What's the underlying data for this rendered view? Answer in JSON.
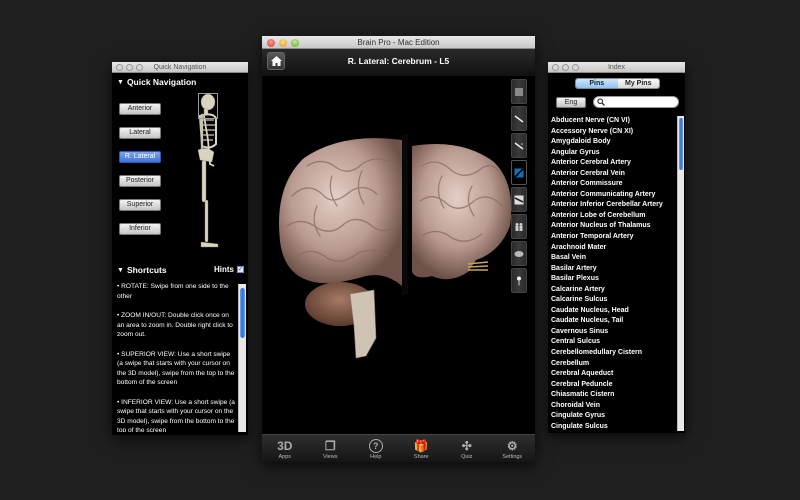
{
  "quick_nav": {
    "window_title": "Quick Navigation",
    "section_title": "Quick Navigation",
    "view_buttons": [
      {
        "label": "Anterior",
        "active": false
      },
      {
        "label": "Lateral",
        "active": false
      },
      {
        "label": "R. Lateral",
        "active": true
      },
      {
        "label": "Posterior",
        "active": false
      },
      {
        "label": "Superior",
        "active": false
      },
      {
        "label": "Inferior",
        "active": false
      }
    ],
    "shortcuts_title": "Shortcuts",
    "hints_label": "Hints",
    "hints_checked": true,
    "shortcuts": [
      "• ROTATE: Swipe from one side to the other",
      "• ZOOM IN/OUT: Double click once on an area to zoom in. Double right click to zoom out.",
      "• SUPERIOR VIEW: Use a short swipe (a swipe that starts with your cursor on the 3D model), swipe from the top to the bottom of the screen",
      "• INFERIOR VIEW: Use a short swipe (a swipe that starts with your cursor on the 3D model), swipe from the bottom to the top of the screen"
    ]
  },
  "main": {
    "window_title": "Brain Pro - Mac Edition",
    "view_title": "R. Lateral: Cerebrum - L5",
    "tools": [
      {
        "icon": "square-icon",
        "active": false
      },
      {
        "icon": "scalpel-icon",
        "active": false
      },
      {
        "icon": "scalpel-alt-icon",
        "active": false
      },
      {
        "icon": "slice-active-icon",
        "active": true
      },
      {
        "icon": "slice-icon",
        "active": false
      },
      {
        "icon": "people-icon",
        "active": false
      },
      {
        "icon": "brain-icon",
        "active": false
      },
      {
        "icon": "pin-icon",
        "active": false
      }
    ],
    "bottom_bar": [
      {
        "label": "Apps",
        "icon": "3d-icon",
        "glyph": "3D"
      },
      {
        "label": "Views",
        "icon": "views-icon",
        "glyph": "❐"
      },
      {
        "label": "Help",
        "icon": "help-icon",
        "glyph": "?"
      },
      {
        "label": "Share",
        "icon": "gift-icon",
        "glyph": "🎁"
      },
      {
        "label": "Quiz",
        "icon": "puzzle-icon",
        "glyph": "✣"
      },
      {
        "label": "Settings",
        "icon": "gear-icon",
        "glyph": "⚙"
      }
    ]
  },
  "index": {
    "window_title": "Index",
    "tabs": [
      {
        "label": "Pins",
        "active": true
      },
      {
        "label": "My Pins",
        "active": false
      }
    ],
    "language_button": "Eng",
    "search_value": "",
    "items": [
      "Abducent Nerve (CN VI)",
      "Accessory Nerve (CN XI)",
      "Amygdaloid Body",
      "Angular Gyrus",
      "Anterior Cerebral Artery",
      "Anterior Cerebral Vein",
      "Anterior Commissure",
      "Anterior Communicating Artery",
      "Anterior Inferior Cerebellar Artery",
      "Anterior Lobe of Cerebellum",
      "Anterior Nucleus of Thalamus",
      "Anterior Temporal Artery",
      "Arachnoid Mater",
      "Basal Vein",
      "Basilar Artery",
      "Basilar Plexus",
      "Calcarine Artery",
      "Calcarine Sulcus",
      "Caudate Nucleus, Head",
      "Caudate Nucleus, Tail",
      "Cavernous Sinus",
      "Central Sulcus",
      "Cerebellomedullary Cistern",
      "Cerebellum",
      "Cerebral Aqueduct",
      "Cerebral Peduncle",
      "Chiasmatic Cistern",
      "Choroidal Vein",
      "Cingulate Gyrus",
      "Cingulate Sulcus"
    ]
  }
}
